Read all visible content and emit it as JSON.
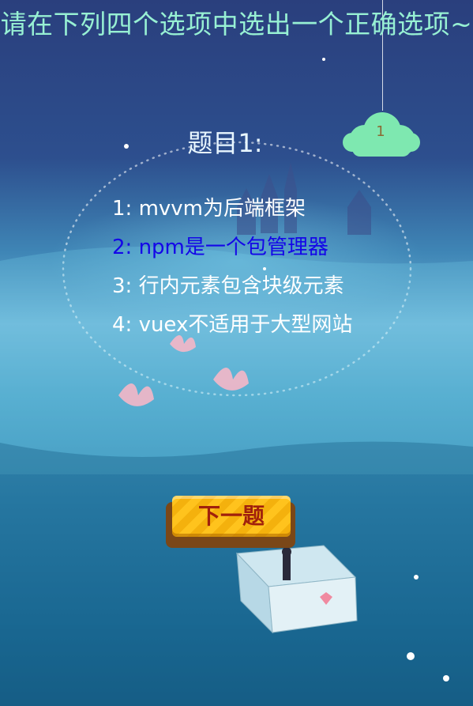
{
  "header": {
    "title": "请在下列四个选项中选出一个正确选项~"
  },
  "badge": {
    "count": "1"
  },
  "question": {
    "label": "题目1:"
  },
  "options": [
    {
      "label": "1: mvvm为后端框架",
      "selected": false
    },
    {
      "label": "2: npm是一个包管理器",
      "selected": true
    },
    {
      "label": "3: 行内元素包含块级元素",
      "selected": false
    },
    {
      "label": "4: vuex不适用于大型网站",
      "selected": false
    }
  ],
  "next_button": {
    "label": "下一题"
  },
  "colors": {
    "title": "#97f0d3",
    "selected_option": "#1406e8",
    "option": "#ffffff",
    "button": "#ffc31d",
    "button_text": "#a0200c",
    "cloud": "#7ee8b0"
  }
}
